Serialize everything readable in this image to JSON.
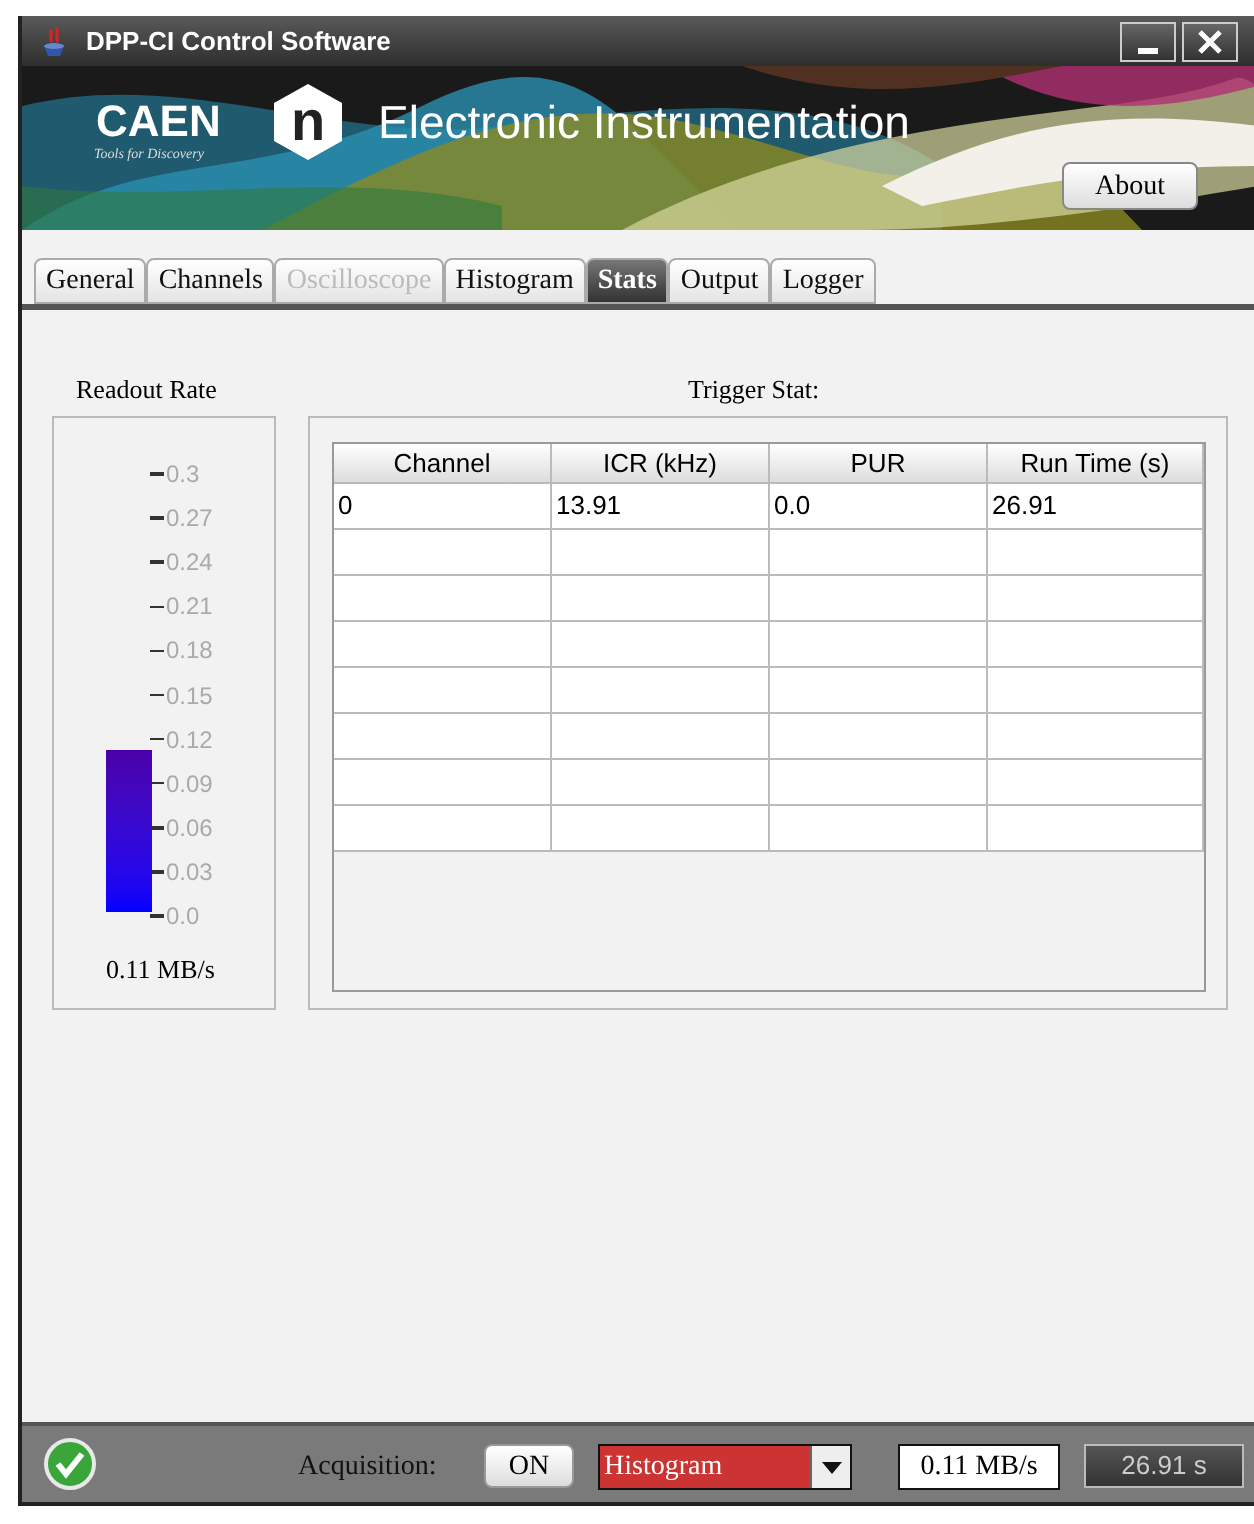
{
  "window": {
    "title": "DPP-CI Control Software"
  },
  "banner": {
    "logo": "CAEN",
    "tagline": "Tools for Discovery",
    "mark": "n",
    "heading": "Electronic Instrumentation",
    "about_button": "About"
  },
  "tabs": [
    {
      "label": "General",
      "selected": false,
      "disabled": false
    },
    {
      "label": "Channels",
      "selected": false,
      "disabled": false
    },
    {
      "label": "Oscilloscope",
      "selected": false,
      "disabled": true
    },
    {
      "label": "Histogram",
      "selected": false,
      "disabled": false
    },
    {
      "label": "Stats",
      "selected": true,
      "disabled": false
    },
    {
      "label": "Output",
      "selected": false,
      "disabled": false
    },
    {
      "label": "Logger",
      "selected": false,
      "disabled": false
    }
  ],
  "readout_rate": {
    "title": "Readout Rate",
    "scale": [
      "0.3",
      "0.27",
      "0.24",
      "0.21",
      "0.18",
      "0.15",
      "0.12",
      "0.09",
      "0.06",
      "0.03",
      "0.0"
    ],
    "reading": "0.11 MB/s"
  },
  "trigger_stats": {
    "title": "Trigger Stat:",
    "columns": [
      "Channel",
      "ICR (kHz)",
      "PUR",
      "Run Time (s)"
    ],
    "rows": [
      [
        "0",
        "13.91",
        "0.0",
        "26.91"
      ]
    ]
  },
  "status_bar": {
    "ok": true,
    "acquisition_label": "Acquisition:",
    "acquisition_button": "ON",
    "mode": "Histogram",
    "rate": "0.11 MB/s",
    "time": "26.91 s"
  }
}
